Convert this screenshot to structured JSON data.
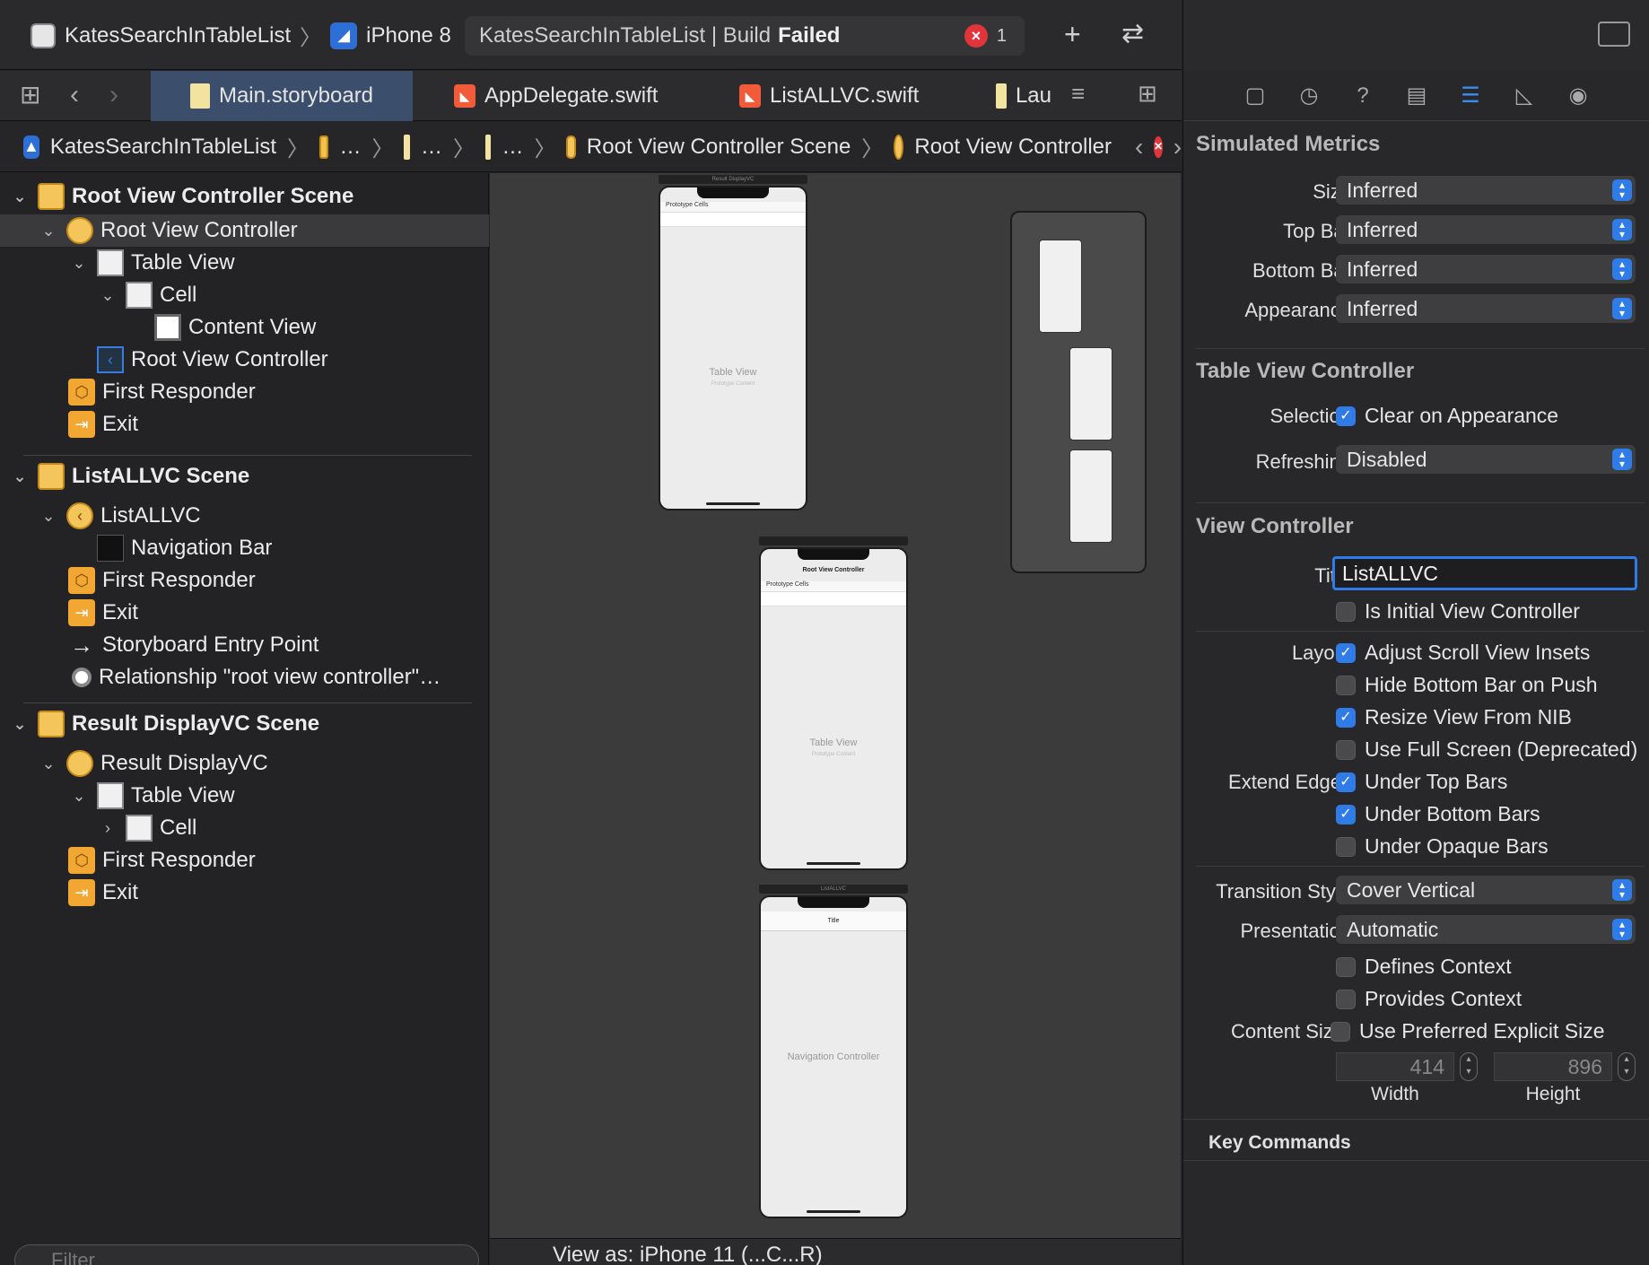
{
  "toolbar": {
    "project": "KatesSearchInTableList",
    "device": "iPhone 8",
    "status_project": "KatesSearchInTableList | Build",
    "status_result": "Failed",
    "error_count": "1"
  },
  "tabs": [
    "Main.storyboard",
    "AppDelegate.swift",
    "ListALLVC.swift",
    "Lau"
  ],
  "breadcrumb": {
    "project": "KatesSearchInTableList",
    "ellipsis": "…",
    "scene": "Root View Controller Scene",
    "controller": "Root View Controller"
  },
  "outline": {
    "rows": [
      "Root View Controller Scene",
      "Root View Controller",
      "Table View",
      "Cell",
      "Content View",
      "Root View Controller",
      "First Responder",
      "Exit",
      "ListALLVC Scene",
      "ListALLVC",
      "Navigation Bar",
      "First Responder",
      "Exit",
      "Storyboard Entry Point",
      "Relationship \"root view controller\"…",
      "Result DisplayVC Scene",
      "Result DisplayVC",
      "Table View",
      "Cell",
      "First Responder",
      "Exit"
    ],
    "filter_placeholder": "Filter"
  },
  "canvas": {
    "result_scene_bar": "Result DisplayVC",
    "prototype_cells": "Prototype Cells",
    "table_view": "Table View",
    "prototype_content": "Prototype Content",
    "root_nav_title": "Root View Controller",
    "listall_bar": "ListALLVC",
    "nav_title": "Title",
    "nav_controller": "Navigation Controller",
    "view_as": "View as: iPhone 11 (...C...R)"
  },
  "inspector": {
    "simulated_metrics": "Simulated Metrics",
    "size_label": "Size",
    "size_value": "Inferred",
    "topbar_label": "Top Bar",
    "topbar_value": "Inferred",
    "bottombar_label": "Bottom Bar",
    "bottombar_value": "Inferred",
    "appearance_label": "Appearance",
    "appearance_value": "Inferred",
    "tvc_title": "Table View Controller",
    "selection_label": "Selection",
    "clear_on_appearance": "Clear on Appearance",
    "refreshing_label": "Refreshing",
    "refreshing_value": "Disabled",
    "vc_title": "View Controller",
    "title_label": "Title",
    "title_value": "ListALLVC",
    "initial_vc": "Is Initial View Controller",
    "layout_label": "Layout",
    "adjust_insets": "Adjust Scroll View Insets",
    "hide_bottom": "Hide Bottom Bar on Push",
    "resize_nib": "Resize View From NIB",
    "full_screen": "Use Full Screen (Deprecated)",
    "extend_edges_label": "Extend Edges",
    "under_top": "Under Top Bars",
    "under_bottom": "Under Bottom Bars",
    "under_opaque": "Under Opaque Bars",
    "transition_label": "Transition Style",
    "transition_value": "Cover Vertical",
    "presentation_label": "Presentation",
    "presentation_value": "Automatic",
    "defines_context": "Defines Context",
    "provides_context": "Provides Context",
    "content_size_label": "Content Size",
    "preferred_size": "Use Preferred Explicit Size",
    "width_value": "414",
    "height_value": "896",
    "width_label": "Width",
    "height_label": "Height",
    "key_commands": "Key Commands"
  },
  "colors": {
    "accent": "#2f7be8",
    "error": "#e0353b",
    "scene_icon": "#f3c55a"
  }
}
